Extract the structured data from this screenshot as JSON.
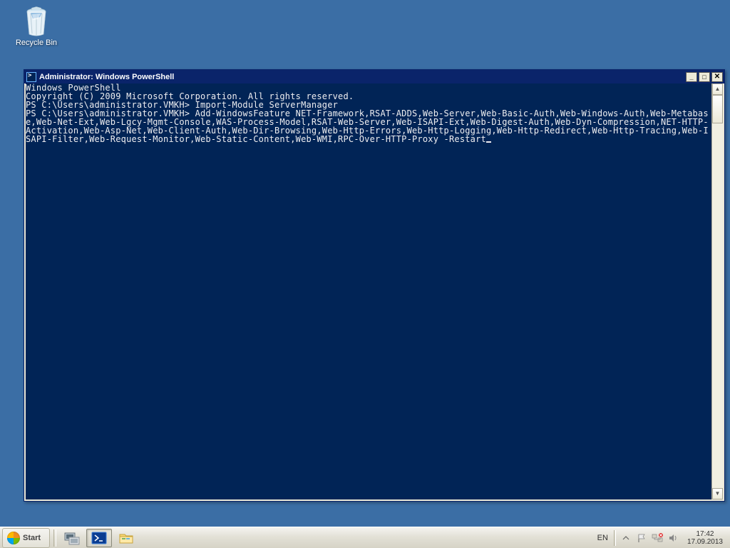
{
  "desktop": {
    "recycle_bin_label": "Recycle Bin"
  },
  "window": {
    "title": "Administrator: Windows PowerShell",
    "console_lines": [
      "Windows PowerShell",
      "Copyright (C) 2009 Microsoft Corporation. All rights reserved.",
      "",
      "PS C:\\Users\\administrator.VMKH> Import-Module ServerManager",
      "PS C:\\Users\\administrator.VMKH> Add-WindowsFeature NET-Framework,RSAT-ADDS,Web-Server,Web-Basic-Auth,Web-Windows-Auth,Web-Metabase,Web-Net-Ext,Web-Lgcy-Mgmt-Console,WAS-Process-Model,RSAT-Web-Server,Web-ISAPI-Ext,Web-Digest-Auth,Web-Dyn-Compression,NET-HTTP-Activation,Web-Asp-Net,Web-Client-Auth,Web-Dir-Browsing,Web-Http-Errors,Web-Http-Logging,Web-Http-Redirect,Web-Http-Tracing,Web-ISAPI-Filter,Web-Request-Monitor,Web-Static-Content,Web-WMI,RPC-Over-HTTP-Proxy -Restart"
    ]
  },
  "taskbar": {
    "start_label": "Start",
    "language": "EN",
    "time": "17:42",
    "date": "17.09.2013"
  }
}
